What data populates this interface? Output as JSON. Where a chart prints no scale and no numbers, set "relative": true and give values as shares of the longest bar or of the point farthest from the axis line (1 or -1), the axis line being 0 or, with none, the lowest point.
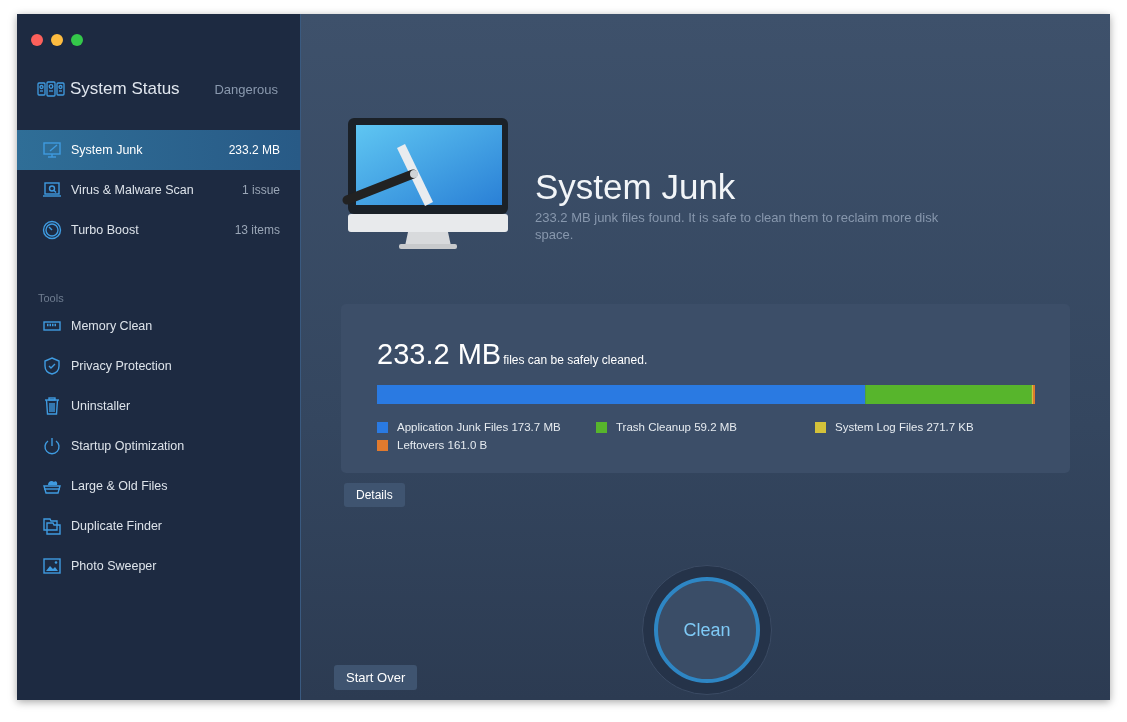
{
  "window": {
    "title": "System Status",
    "status": "Dangerous"
  },
  "sidebar": {
    "items": [
      {
        "label": "System Junk",
        "value": "233.2 MB",
        "selected": true
      },
      {
        "label": "Virus & Malware Scan",
        "value": "1 issue",
        "selected": false
      },
      {
        "label": "Turbo Boost",
        "value": "13 items",
        "selected": false
      }
    ],
    "tools_heading": "Tools",
    "tools": [
      {
        "label": "Memory Clean",
        "selected": false
      },
      {
        "label": "Privacy Protection",
        "selected": false
      },
      {
        "label": "Uninstaller",
        "selected": false
      },
      {
        "label": "Startup Optimization",
        "selected": false
      },
      {
        "label": "Large & Old Files",
        "selected": false
      },
      {
        "label": "Duplicate Finder",
        "selected": false
      },
      {
        "label": "Photo Sweeper",
        "selected": false
      }
    ]
  },
  "header": {
    "title": "System Junk",
    "description": "233.2 MB junk files found.  It is safe to clean them to reclaim more disk space."
  },
  "summary": {
    "total": "233.2 MB",
    "caption": "files can be safely cleaned.",
    "chart_data": {
      "type": "bar",
      "orientation": "horizontal",
      "stacked": true,
      "relative": true,
      "series": [
        {
          "name": "Application Junk Files 173.7 MB",
          "color": "#2a7ae2",
          "values": [
            0.742
          ]
        },
        {
          "name": "Trash Cleanup 59.2 MB",
          "color": "#57b52c",
          "values": [
            0.253
          ]
        },
        {
          "name": "System Log Files 271.7 KB",
          "color": "#d4c23a",
          "values": [
            0.002
          ]
        },
        {
          "name": "Leftovers 161.0 B",
          "color": "#e07a2e",
          "values": [
            0.003
          ]
        }
      ]
    }
  },
  "buttons": {
    "details": "Details",
    "clean": "Clean",
    "start_over": "Start Over"
  }
}
